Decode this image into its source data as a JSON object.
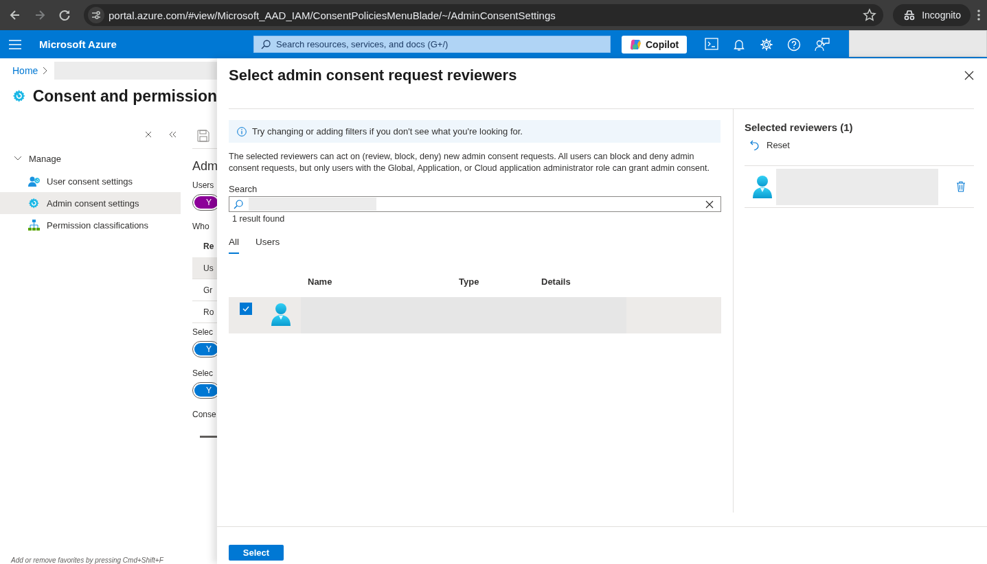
{
  "browser": {
    "url": "portal.azure.com/#view/Microsoft_AAD_IAM/ConsentPoliciesMenuBlade/~/AdminConsentSettings",
    "profile": "Incognito"
  },
  "portal_header": {
    "brand": "Microsoft Azure",
    "search": {
      "placeholder": "Search resources, services, and docs (G+/)"
    },
    "copilot": "Copilot"
  },
  "breadcrumb": [
    "Home"
  ],
  "page": {
    "title": "Consent and permission",
    "nav": {
      "group": "Manage",
      "expanded": true,
      "items": [
        {
          "label": "User consent settings",
          "kind": "user-gear",
          "selected": false
        },
        {
          "label": "Admin consent settings",
          "kind": "gear",
          "selected": true
        },
        {
          "label": "Permission classifications",
          "kind": "hierarchy",
          "selected": false
        }
      ]
    },
    "settings": [
      {
        "kind": "heading",
        "text": "Adm"
      },
      {
        "kind": "label",
        "text": "Users"
      },
      {
        "kind": "toggle",
        "text": "Y",
        "modified": true
      },
      {
        "kind": "label",
        "text": "Who"
      },
      {
        "kind": "header",
        "text": "Re"
      },
      {
        "kind": "row",
        "text": "Us",
        "selected": true
      },
      {
        "kind": "row",
        "text": "Gr",
        "selected": false
      },
      {
        "kind": "row",
        "text": "Ro",
        "selected": false
      },
      {
        "kind": "label",
        "text": "Selec"
      },
      {
        "kind": "toggle",
        "text": "Y",
        "modified": false
      },
      {
        "kind": "label",
        "text": "Selec"
      },
      {
        "kind": "toggle",
        "text": "Y",
        "modified": false
      },
      {
        "kind": "label",
        "text": "Conse"
      },
      {
        "kind": "bar"
      }
    ],
    "hint": "Add or remove favorites by pressing Cmd+Shift+F"
  },
  "blade": {
    "title": "Select admin consent request reviewers",
    "info": "Try changing or adding filters if you don't see what you're looking for.",
    "description": "The selected reviewers can act on (review, block, deny) new admin consent requests. All users can block and deny admin consent requests, but only users with the Global, Application, or Cloud application administrator role can grant admin consent.",
    "search": {
      "label": "Search"
    },
    "result_count": "1 result found",
    "tabs": [
      {
        "label": "All",
        "selected": true
      },
      {
        "label": "Users",
        "selected": false
      }
    ],
    "table": {
      "columns": [
        "Name",
        "Type",
        "Details"
      ],
      "rows": [
        {
          "kind": "user",
          "checked": true,
          "selected": true
        }
      ]
    },
    "selected_panel": {
      "title": "Selected reviewers (1)",
      "reset": "Reset",
      "reviewers": [
        {
          "kind": "user"
        }
      ]
    },
    "primary_button": "Select"
  }
}
